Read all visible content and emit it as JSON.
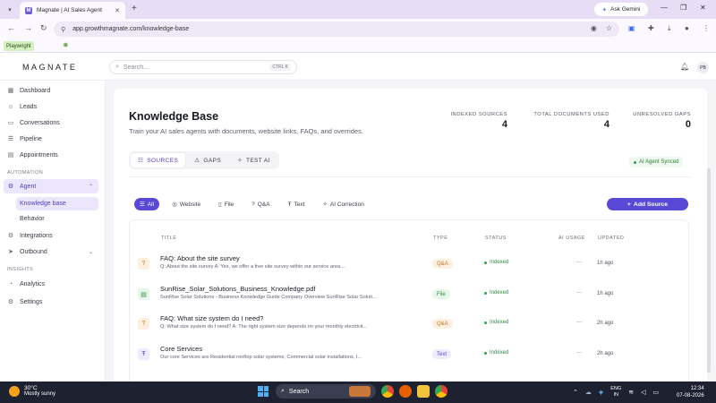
{
  "browser": {
    "tab_title": "Magnate | AI Sales Agent",
    "tab_favicon": "M",
    "new_tab": "+",
    "ask_gemini": "Ask Gemini",
    "url": "app.growthmagnate.com/knowledge-base",
    "bookmark_label": "Playwright"
  },
  "header": {
    "logo": "MAGNATE",
    "search_placeholder": "Search...",
    "search_shortcut": "CTRL K",
    "avatar_initials": "PB"
  },
  "sidebar": {
    "items_top": [
      {
        "label": "Dashboard",
        "icon": "grid-icon",
        "glyph": "▦"
      },
      {
        "label": "Leads",
        "icon": "users-icon",
        "glyph": "☺"
      },
      {
        "label": "Conversations",
        "icon": "chat-icon",
        "glyph": "▭"
      },
      {
        "label": "Pipeline",
        "icon": "pipeline-icon",
        "glyph": "☰"
      },
      {
        "label": "Appointments",
        "icon": "calendar-icon",
        "glyph": "▤"
      }
    ],
    "section_automation": "AUTOMATION",
    "agent_label": "Agent",
    "agent_children": [
      "Knowledge base",
      "Behavior"
    ],
    "items_mid": [
      {
        "label": "Integrations",
        "icon": "plug-icon",
        "glyph": "⚙"
      },
      {
        "label": "Outbound",
        "icon": "send-icon",
        "glyph": "➤"
      }
    ],
    "section_insights": "INSIGHTS",
    "items_bottom": [
      {
        "label": "Analytics",
        "icon": "analytics-icon",
        "glyph": "◔"
      },
      {
        "label": "Settings",
        "icon": "gear-icon",
        "glyph": "⚙"
      }
    ]
  },
  "page": {
    "title": "Knowledge Base",
    "subtitle": "Train your AI sales agents with documents, website links, FAQs, and overrides.",
    "stats": [
      {
        "label": "INDEXED SOURCES",
        "value": "4"
      },
      {
        "label": "TOTAL DOCUMENTS USED",
        "value": "4"
      },
      {
        "label": "UNRESOLVED GAPS",
        "value": "0"
      }
    ],
    "tabs": [
      "SOURCES",
      "GAPS",
      "TEST AI"
    ],
    "synced": "AI Agent Synced",
    "filters": [
      "All",
      "Website",
      "File",
      "Q&A",
      "Text",
      "AI Correction"
    ],
    "add_source": "Add Source",
    "columns": [
      "TITLE",
      "TYPE",
      "STATUS",
      "AI USAGE",
      "UPDATED"
    ],
    "rows": [
      {
        "title": "FAQ: About the site survey",
        "desc": "Q: About the site survey A: Yes, we offer a free site survey within our service area....",
        "type": "Q&A",
        "status": "Indexed",
        "usage": "—",
        "updated": "1h ago"
      },
      {
        "title": "SunRise_Solar_Solutions_Business_Knowledge.pdf",
        "desc": "SunRise Solar Solutions - Business Knowledge Guide Company Overview SunRise Solar Soluti...",
        "type": "File",
        "status": "Indexed",
        "usage": "—",
        "updated": "1h ago"
      },
      {
        "title": "FAQ: What size system do I need?",
        "desc": "Q: What size system do I need? A: The right system size depends on your monthly electricit...",
        "type": "Q&A",
        "status": "Indexed",
        "usage": "—",
        "updated": "2h ago"
      },
      {
        "title": "Core Services",
        "desc": "Our core Services are Residential rooftop solar systems, Commercial solar installations, I...",
        "type": "Text",
        "status": "Indexed",
        "usage": "—",
        "updated": "2h ago"
      }
    ]
  },
  "taskbar": {
    "temp": "30°C",
    "weather": "Mostly sunny",
    "search": "Search",
    "lang_1": "ENG",
    "lang_2": "IN",
    "time": "12:34",
    "date": "07-08-2026"
  },
  "colors": {
    "accent": "#5a49d6",
    "active_bg": "#ebe6fb",
    "qa_badge_bg": "#fdf0e1",
    "qa_badge_fg": "#c07324",
    "file_badge_bg": "#e6f6ea",
    "file_badge_fg": "#2f8a45",
    "text_badge_bg": "#efebfc",
    "text_badge_fg": "#5a49d6"
  }
}
